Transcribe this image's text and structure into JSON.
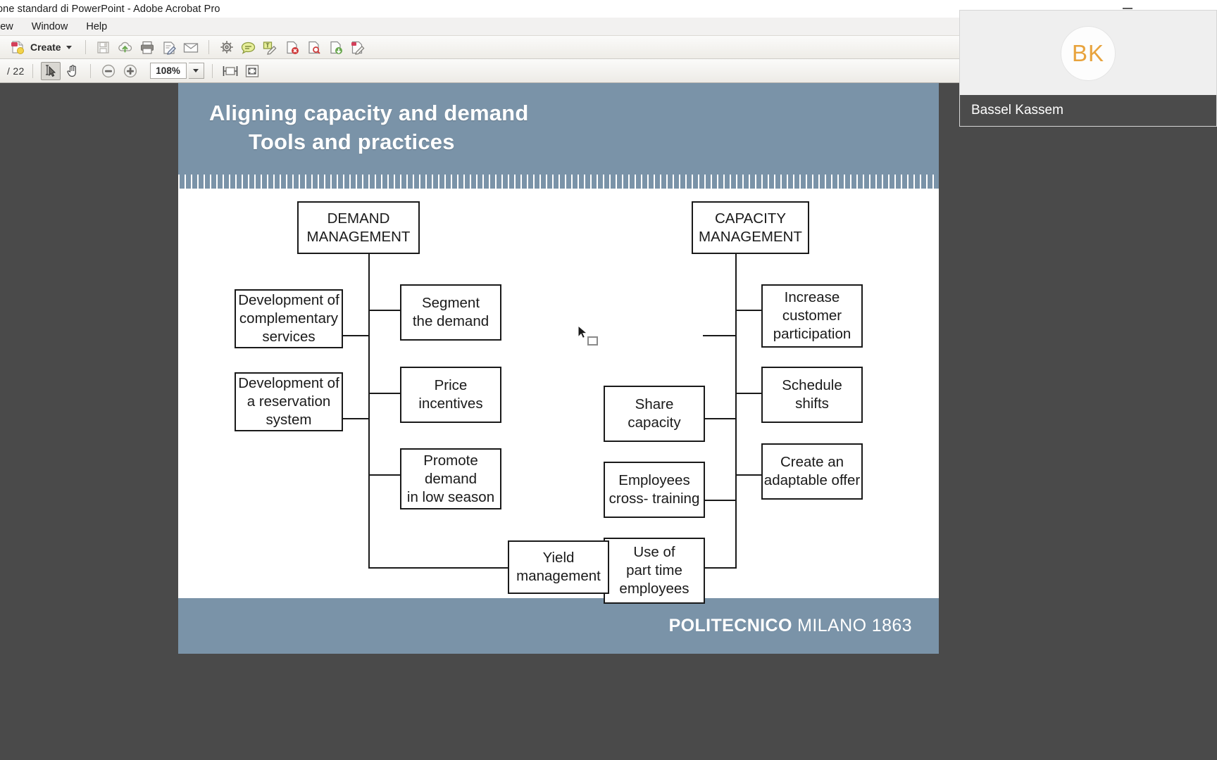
{
  "window": {
    "title": "one standard di PowerPoint - Adobe Acrobat Pro",
    "minimize_label": "minimize"
  },
  "menubar": {
    "items": [
      {
        "label": "iew"
      },
      {
        "label": "Window"
      },
      {
        "label": "Help"
      }
    ]
  },
  "toolbar_main": {
    "create_label": "Create",
    "icons": [
      {
        "name": "save-icon",
        "glyph": "save"
      },
      {
        "name": "cloud-upload-icon",
        "glyph": "cloud"
      },
      {
        "name": "print-icon",
        "glyph": "print"
      },
      {
        "name": "sign-icon",
        "glyph": "sign"
      },
      {
        "name": "email-icon",
        "glyph": "email"
      },
      {
        "name": "settings-gear-icon",
        "glyph": "gear"
      },
      {
        "name": "comment-icon",
        "glyph": "comment"
      },
      {
        "name": "text-edit-icon",
        "glyph": "textedit"
      },
      {
        "name": "delete-page-icon",
        "glyph": "delpage"
      },
      {
        "name": "search-page-icon",
        "glyph": "searchpage"
      },
      {
        "name": "export-page-icon",
        "glyph": "exportpage"
      },
      {
        "name": "edit-pdf-icon",
        "glyph": "editpdf"
      }
    ]
  },
  "toolbar_nav": {
    "page_indicator": "/ 22",
    "select_tool_label": "select-tool",
    "hand_tool_label": "hand-tool",
    "zoom_out_label": "zoom-out",
    "zoom_in_label": "zoom-in",
    "zoom_value": "108%",
    "fit_width_label": "fit-width",
    "fit_page_label": "fit-page"
  },
  "slide": {
    "title_line1": "Aligning capacity and demand",
    "title_line2": "Tools and practices",
    "footer_bold": "POLITECNICO",
    "footer_light": " MILANO 1863",
    "header_color": "#7a93a8",
    "boxes": {
      "demand_management": "DEMAND\nMANAGEMENT",
      "capacity_management": "CAPACITY\nMANAGEMENT",
      "dev_complementary": "Development of\ncomplementary\nservices",
      "dev_reservation": "Development of\na reservation\nsystem",
      "segment_demand": "Segment\nthe demand",
      "price_incentives": "Price\nincentives",
      "promote_demand": "Promote\ndemand\nin low season",
      "share_capacity": "Share\ncapacity",
      "employees_cross_training": "Employees\ncross- training",
      "part_time_employees": "Use of\npart time\nemployees",
      "increase_participation": "Increase\ncustomer\nparticipation",
      "schedule_shifts": "Schedule\nshifts",
      "adaptable_offer": "Create an\nadaptable offer",
      "yield_management": "Yield\nmanagement"
    }
  },
  "video": {
    "initials": "BK",
    "name": "Bassel Kassem"
  }
}
